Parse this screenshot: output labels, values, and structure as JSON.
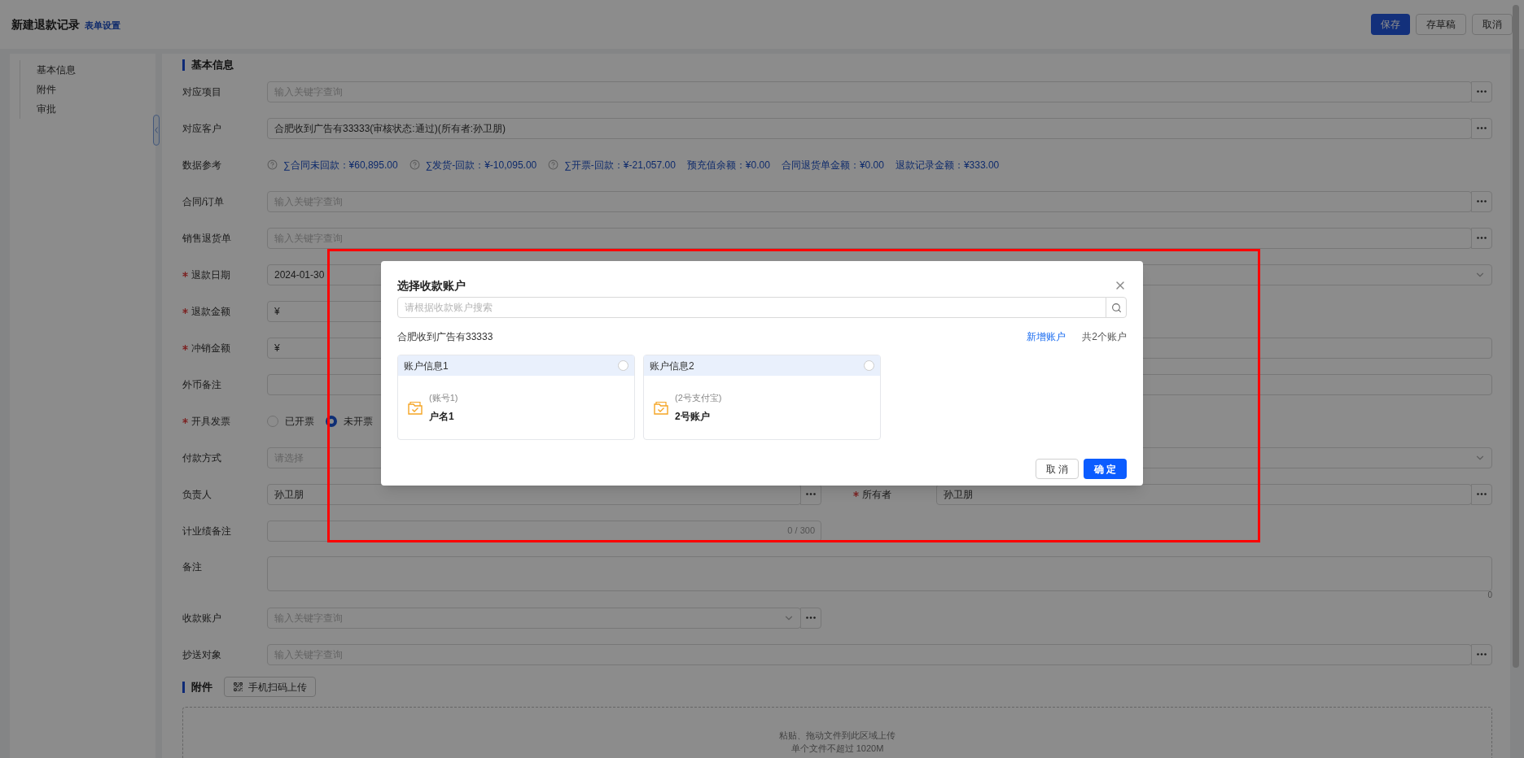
{
  "header": {
    "title": "新建退款记录",
    "settings_link": "表单设置",
    "buttons": [
      {
        "label": "保存",
        "kind": "primary"
      },
      {
        "label": "存草稿",
        "kind": "default"
      },
      {
        "label": "取消",
        "kind": "default"
      }
    ]
  },
  "nav": {
    "items": [
      {
        "label": "基本信息"
      },
      {
        "label": "附件"
      },
      {
        "label": "审批"
      }
    ]
  },
  "basic_info": {
    "title": "基本信息",
    "rows": [
      {
        "kind": "field",
        "left": {
          "label": "对应项目",
          "required": false,
          "wide": true,
          "kind": "lookup",
          "placeholder": "输入关键字查询"
        }
      },
      {
        "kind": "field",
        "left": {
          "label": "对应客户",
          "required": false,
          "wide": true,
          "kind": "lookup",
          "value": "合肥收到广告有33333(审核状态:通过)(所有者:孙卫朋)"
        }
      },
      {
        "kind": "refs",
        "label": "数据参考",
        "items": [
          {
            "text": "∑合同未回款：¥60,895.00",
            "help": true
          },
          {
            "text": "∑发货-回款：¥-10,095.00",
            "help": true
          },
          {
            "text": "∑开票-回款：¥-21,057.00",
            "help": true
          },
          {
            "text": "预充值余额：¥0.00",
            "help": false
          },
          {
            "text": "合同退货单金额：¥0.00",
            "help": false
          },
          {
            "text": "退款记录金额：¥333.00",
            "help": false
          }
        ]
      },
      {
        "kind": "field",
        "left": {
          "label": "合同/订单",
          "required": false,
          "wide": true,
          "kind": "lookup",
          "placeholder": "输入关键字查询"
        }
      },
      {
        "kind": "field",
        "left": {
          "label": "销售退货单",
          "required": false,
          "wide": true,
          "kind": "lookup",
          "placeholder": "输入关键字查询"
        }
      },
      {
        "kind": "field",
        "left": {
          "label": "退款日期",
          "required": true,
          "wide": false,
          "kind": "input",
          "value": "2024-01-30"
        },
        "right": {
          "kind": "select"
        }
      },
      {
        "kind": "field",
        "left": {
          "label": "退款金额",
          "required": true,
          "wide": false,
          "kind": "input",
          "value": "¥"
        }
      },
      {
        "kind": "field",
        "left": {
          "label": "冲销金额",
          "required": true,
          "wide": false,
          "kind": "input",
          "value": "¥"
        },
        "right": {
          "kind": "input"
        }
      },
      {
        "kind": "field",
        "left": {
          "label": "外币备注",
          "required": false,
          "wide": true,
          "kind": "input"
        }
      },
      {
        "kind": "radio",
        "label": "开具发票",
        "required": true,
        "options": [
          {
            "label": "已开票",
            "selected": false
          },
          {
            "label": "未开票",
            "selected": true
          }
        ]
      },
      {
        "kind": "field",
        "left": {
          "label": "付款方式",
          "required": false,
          "wide": false,
          "kind": "input",
          "placeholder": "请选择"
        },
        "right": {
          "kind": "select"
        }
      },
      {
        "kind": "field",
        "left": {
          "label": "负责人",
          "required": false,
          "wide": false,
          "kind": "lookup",
          "value": "孙卫朋"
        },
        "right": {
          "label": "所有者",
          "required": true,
          "kind": "lookup",
          "value": "孙卫朋"
        }
      },
      {
        "kind": "field",
        "left": {
          "label": "计业绩备注",
          "required": false,
          "wide": false,
          "kind": "input",
          "counter": "0 / 300"
        }
      },
      {
        "kind": "textarea",
        "label": "备注",
        "counter": "0"
      },
      {
        "kind": "field",
        "left": {
          "label": "收款账户",
          "required": false,
          "wide": false,
          "kind": "select-lookup",
          "placeholder": "输入关键字查询"
        }
      },
      {
        "kind": "field",
        "left": {
          "label": "抄送对象",
          "required": false,
          "wide": true,
          "kind": "lookup",
          "placeholder": "输入关键字查询"
        }
      }
    ]
  },
  "attachments": {
    "title": "附件",
    "scan_button": "手机扫码上传",
    "drop_text": "粘贴、拖动文件到此区域上传",
    "limit_text": "单个文件不超过 1020M"
  },
  "modal": {
    "title": "选择收款账户",
    "search_placeholder": "请根据收款账户搜索",
    "customer": "合肥收到广告有33333",
    "add_link": "新增账户",
    "count": "共2个账户",
    "accounts": [
      {
        "header": "账户信息1",
        "number": "(账号1)",
        "name": "户名1",
        "selected": false
      },
      {
        "header": "账户信息2",
        "number": "(2号支付宝)",
        "name": "2号账户",
        "selected": false
      }
    ],
    "buttons": [
      {
        "label": "取 消",
        "kind": "default"
      },
      {
        "label": "确 定",
        "kind": "primary"
      }
    ]
  }
}
